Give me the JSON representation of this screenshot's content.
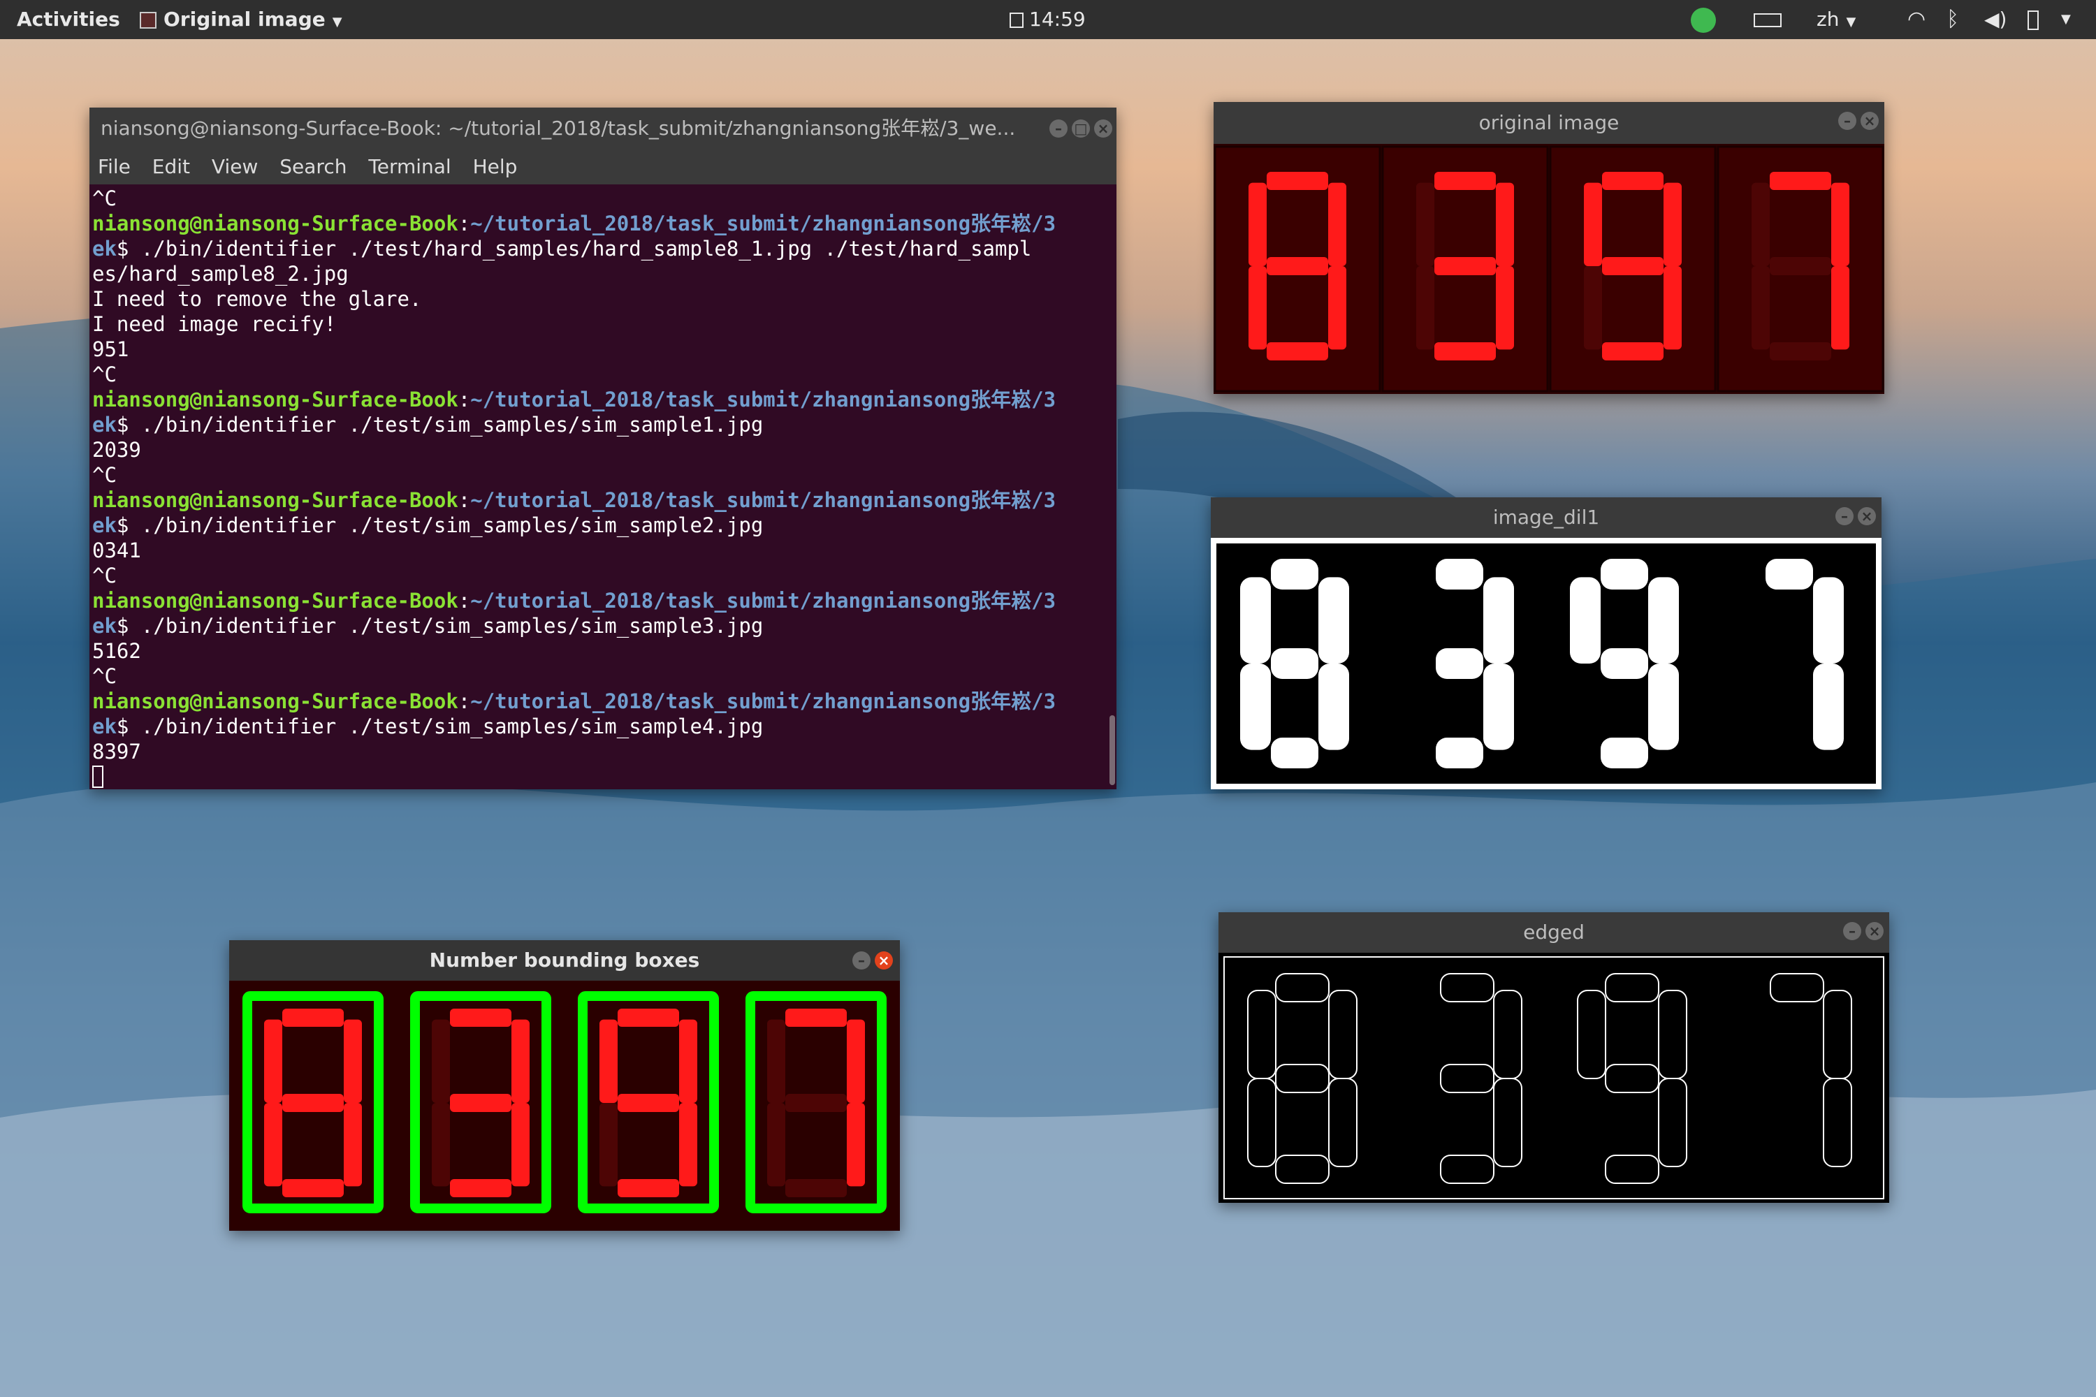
{
  "topbar": {
    "activities": "Activities",
    "app_menu": "Original image",
    "clock": "14:59",
    "lang": "zh"
  },
  "terminal": {
    "title": "niansong@niansong-Surface-Book: ~/tutorial_2018/task_submit/zhangniansong张年崧/3_we...",
    "menu": [
      "File",
      "Edit",
      "View",
      "Search",
      "Terminal",
      "Help"
    ],
    "lines": [
      {
        "type": "out",
        "text": "^C"
      },
      {
        "type": "prompt",
        "user": "niansong@niansong-Surface-Book",
        "path": "~/tutorial_2018/task_submit/zhangniansong张年崧/3"
      },
      {
        "type": "cmd",
        "head": "ek",
        "text": "$ ./bin/identifier ./test/hard_samples/hard_sample8_1.jpg ./test/hard_sampl"
      },
      {
        "type": "out",
        "text": "es/hard_sample8_2.jpg"
      },
      {
        "type": "out",
        "text": "I need to remove the glare."
      },
      {
        "type": "out",
        "text": "I need image recify!"
      },
      {
        "type": "out",
        "text": "951"
      },
      {
        "type": "out",
        "text": "^C"
      },
      {
        "type": "prompt",
        "user": "niansong@niansong-Surface-Book",
        "path": "~/tutorial_2018/task_submit/zhangniansong张年崧/3"
      },
      {
        "type": "cmd",
        "head": "ek",
        "text": "$ ./bin/identifier ./test/sim_samples/sim_sample1.jpg"
      },
      {
        "type": "out",
        "text": "2039"
      },
      {
        "type": "out",
        "text": "^C"
      },
      {
        "type": "prompt",
        "user": "niansong@niansong-Surface-Book",
        "path": "~/tutorial_2018/task_submit/zhangniansong张年崧/3"
      },
      {
        "type": "cmd",
        "head": "ek",
        "text": "$ ./bin/identifier ./test/sim_samples/sim_sample2.jpg"
      },
      {
        "type": "out",
        "text": "0341"
      },
      {
        "type": "out",
        "text": "^C"
      },
      {
        "type": "prompt",
        "user": "niansong@niansong-Surface-Book",
        "path": "~/tutorial_2018/task_submit/zhangniansong张年崧/3"
      },
      {
        "type": "cmd",
        "head": "ek",
        "text": "$ ./bin/identifier ./test/sim_samples/sim_sample3.jpg"
      },
      {
        "type": "out",
        "text": "5162"
      },
      {
        "type": "out",
        "text": "^C"
      },
      {
        "type": "prompt",
        "user": "niansong@niansong-Surface-Book",
        "path": "~/tutorial_2018/task_submit/zhangniansong张年崧/3"
      },
      {
        "type": "cmd",
        "head": "ek",
        "text": "$ ./bin/identifier ./test/sim_samples/sim_sample4.jpg"
      },
      {
        "type": "out",
        "text": "8397"
      }
    ]
  },
  "windows": {
    "original": {
      "title": "original image",
      "digits": [
        "8",
        "3",
        "9",
        "7"
      ]
    },
    "dil": {
      "title": "image_dil1",
      "digits": [
        "8",
        "3",
        "9",
        "7"
      ]
    },
    "edged": {
      "title": "edged",
      "digits": [
        "8",
        "3",
        "9",
        "7"
      ]
    },
    "boxes": {
      "title": "Number bounding boxes",
      "digits": [
        "8",
        "3",
        "9",
        "7"
      ]
    }
  },
  "colors": {
    "terminal_bg": "#300a24",
    "prompt_user": "#8ae234",
    "prompt_path": "#729fcf",
    "segment_red": "#ff1a1a",
    "box_green": "#00ff00",
    "close_active": "#e2421c"
  }
}
